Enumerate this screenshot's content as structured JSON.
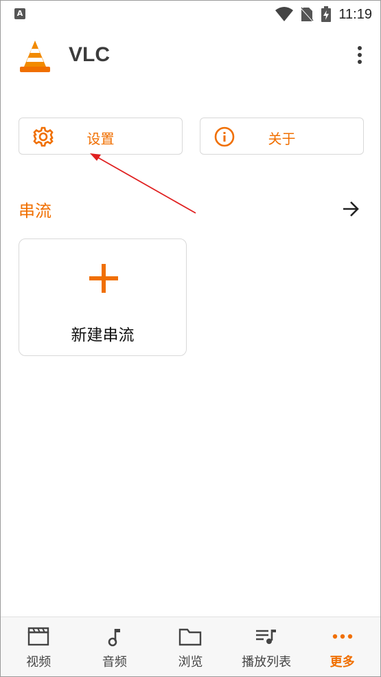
{
  "status_bar": {
    "time": "11:19",
    "left_icon_letter": "A"
  },
  "app_bar": {
    "title": "VLC"
  },
  "actions": {
    "settings_label": "设置",
    "about_label": "关于"
  },
  "streams": {
    "section_title": "串流",
    "new_stream_label": "新建串流"
  },
  "bottom_nav": {
    "items": [
      {
        "label": "视频",
        "icon": "video-icon",
        "active": false
      },
      {
        "label": "音频",
        "icon": "music-note-icon",
        "active": false
      },
      {
        "label": "浏览",
        "icon": "folder-icon",
        "active": false
      },
      {
        "label": "播放列表",
        "icon": "playlist-icon",
        "active": false
      },
      {
        "label": "更多",
        "icon": "more-dots-icon",
        "active": true
      }
    ]
  },
  "colors": {
    "accent": "#f06f00",
    "annotation_arrow": "#e02020"
  }
}
